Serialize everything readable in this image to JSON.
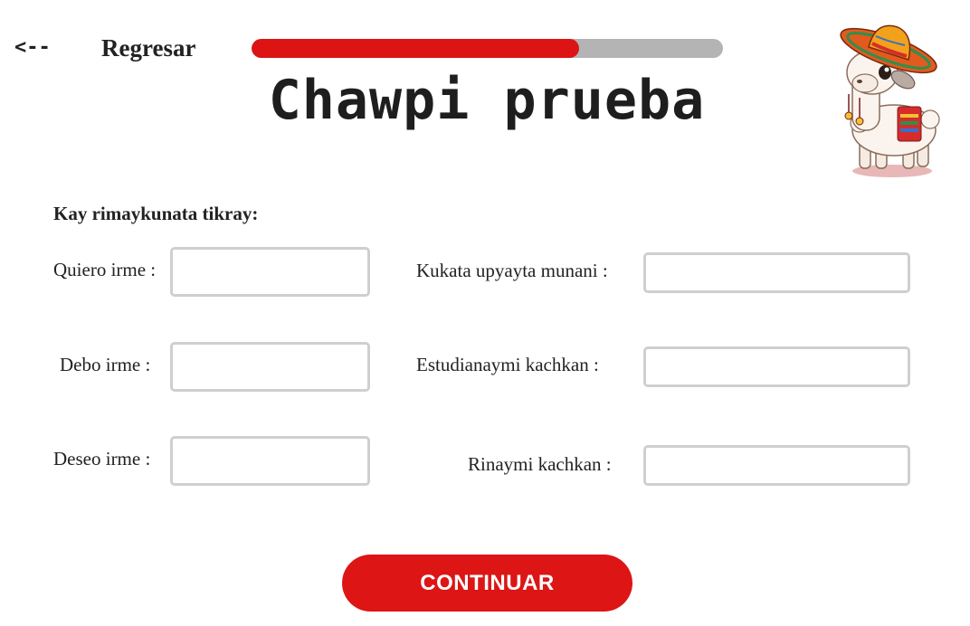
{
  "header": {
    "back_arrow": "<--",
    "back_label": "Regresar",
    "progress": 0.695,
    "title": "Chawpi prueba"
  },
  "mascot": {
    "icon": "llama-sombrero-icon"
  },
  "form": {
    "instructions": "Kay rimaykunata tikray:",
    "fields": [
      {
        "label": "Quiero irme :",
        "value": "",
        "placeholder": ""
      },
      {
        "label": "Debo irme :",
        "value": "",
        "placeholder": ""
      },
      {
        "label": "Deseo irme :",
        "value": "",
        "placeholder": ""
      },
      {
        "label": "Kukata upyayta munani :",
        "value": "",
        "placeholder": ""
      },
      {
        "label": "Estudianaymi kachkan :",
        "value": "",
        "placeholder": ""
      },
      {
        "label": "Rinaymi kachkan :",
        "value": "",
        "placeholder": ""
      }
    ]
  },
  "actions": {
    "continue_label": "CONTINUAR"
  },
  "colors": {
    "accent": "#dc1414",
    "progress_track": "#b4b4b4",
    "input_border": "#cfcfcf"
  }
}
